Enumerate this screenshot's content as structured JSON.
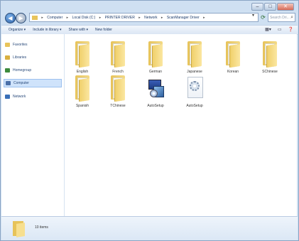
{
  "window": {
    "buttons": {
      "minimize": "–",
      "maximize": "□",
      "close": "✕"
    }
  },
  "address": {
    "crumbs": [
      "Computer",
      "Local Disk (C:)",
      "PRINTER DRIVER",
      "Network",
      "ScanManager Driver"
    ],
    "search_placeholder": "Search Dri..."
  },
  "toolbar": {
    "items": [
      "Organize ▾",
      "Include in library ▾",
      "Share with ▾",
      "New folder"
    ]
  },
  "nav": {
    "items": [
      {
        "label": "Favorites",
        "color": "#e8c45b",
        "selected": false
      },
      {
        "label": "Libraries",
        "color": "#d9b040",
        "selected": false
      },
      {
        "label": "Homegroup",
        "color": "#3c8a3c",
        "selected": false
      },
      {
        "label": "Computer",
        "color": "#4a6fa8",
        "selected": true
      },
      {
        "label": "Network",
        "color": "#3a70b8",
        "selected": false
      }
    ]
  },
  "files": [
    {
      "label": "English",
      "icon": "folder-icon"
    },
    {
      "label": "French",
      "icon": "folder-icon"
    },
    {
      "label": "German",
      "icon": "folder-icon"
    },
    {
      "label": "Japanese",
      "icon": "folder-icon"
    },
    {
      "label": "Korean",
      "icon": "folder-icon"
    },
    {
      "label": "SChinese",
      "icon": "folder-icon"
    },
    {
      "label": "Spanish",
      "icon": "folder-icon"
    },
    {
      "label": "TChinese",
      "icon": "folder-icon"
    },
    {
      "label": "AutoSetup",
      "icon": "setup-icon"
    },
    {
      "label": "AutoSetup",
      "icon": "settings-file-icon"
    }
  ],
  "details": {
    "count": "10 items"
  }
}
